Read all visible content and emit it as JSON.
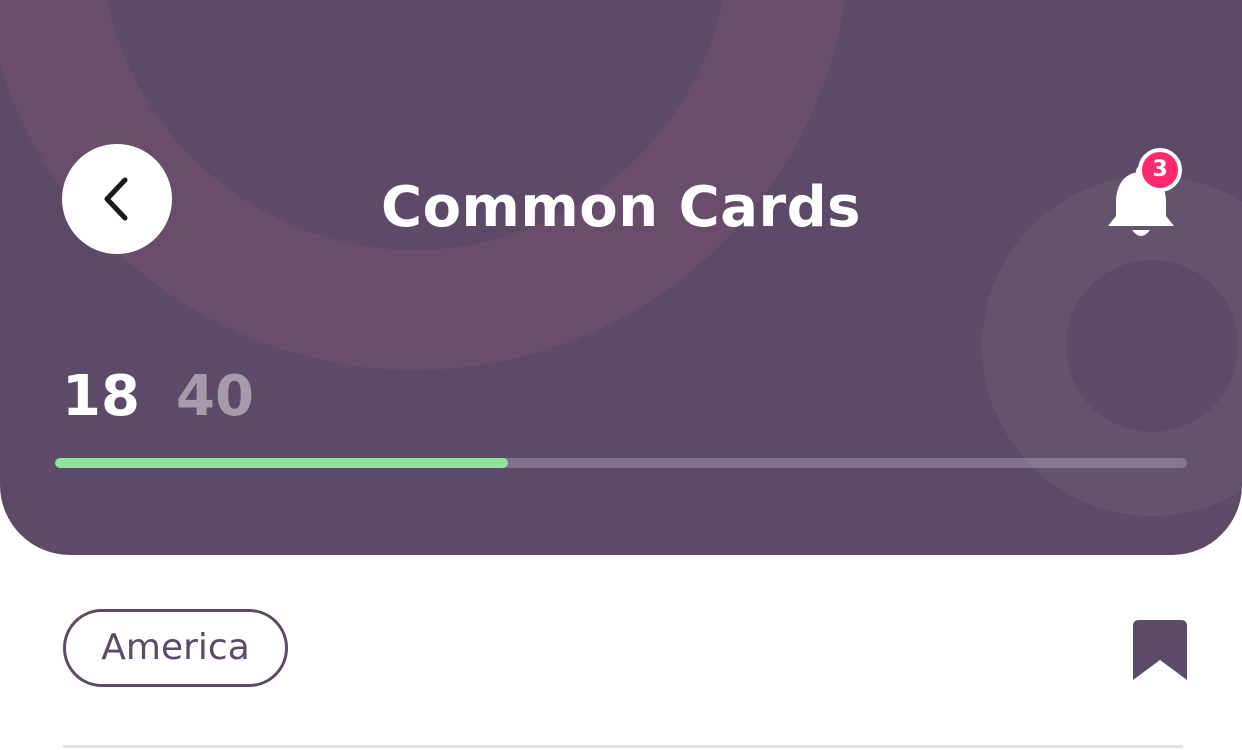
{
  "header": {
    "title": "Common Cards",
    "back_icon": "chevron-left-icon",
    "notification_icon": "bell-icon",
    "notification_count": "3",
    "background_color": "#5c4a66"
  },
  "progress": {
    "current": "18",
    "total": "40",
    "fraction": 0.4,
    "fill_color": "#8fe39a"
  },
  "content": {
    "category_tag": "America",
    "bookmark_icon": "bookmark-icon"
  }
}
